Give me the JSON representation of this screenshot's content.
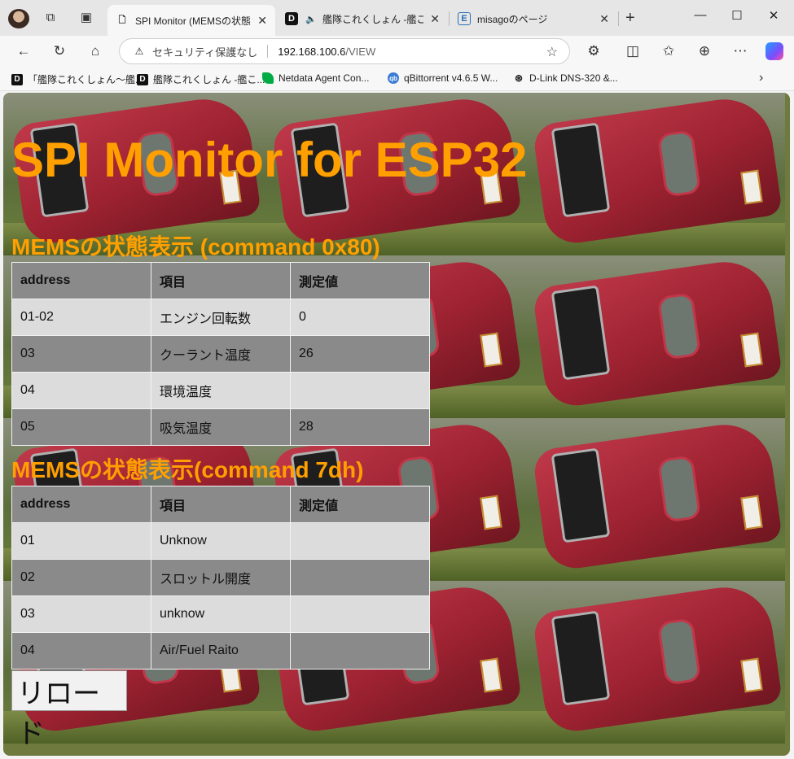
{
  "tabs": [
    {
      "title": "SPI Monitor (MEMSの状態表示",
      "favicon": "page-icon",
      "active": true
    },
    {
      "title": "艦隊これくしょん -艦これ-",
      "favicon": "d-icon",
      "active": false
    },
    {
      "title": "misagoのページ",
      "favicon": "e-icon",
      "active": false
    }
  ],
  "address": {
    "security_text": "セキュリティ保護なし",
    "host": "192.168.100.6",
    "path": "/VIEW"
  },
  "bookmarks": [
    {
      "label": "「艦隊これくしょん～艦...",
      "icon": "d-icon"
    },
    {
      "label": "艦隊これくしょん -艦こ...",
      "icon": "d-icon"
    },
    {
      "label": "Netdata Agent Con...",
      "icon": "netdata-icon"
    },
    {
      "label": "qBittorrent v4.6.5 W...",
      "icon": "qbittorrent-icon"
    },
    {
      "label": "D-Link DNS-320 &...",
      "icon": "dlink-icon"
    }
  ],
  "page": {
    "title": "SPI Monitor for ESP32",
    "section1": {
      "title": "MEMSの状態表示 (command 0x80)",
      "headers": [
        "address",
        "項目",
        "測定値"
      ],
      "rows": [
        [
          "01-02",
          "エンジン回転数",
          "0"
        ],
        [
          "03",
          "クーラント温度",
          "26"
        ],
        [
          "04",
          "環境温度",
          ""
        ],
        [
          "05",
          "吸気温度",
          "28"
        ]
      ]
    },
    "section2": {
      "title": "MEMSの状態表示(command 7dh)",
      "headers": [
        "address",
        "項目",
        "測定値"
      ],
      "rows": [
        [
          "01",
          "Unknow",
          ""
        ],
        [
          "02",
          "スロットル開度",
          ""
        ],
        [
          "03",
          "unknow",
          ""
        ],
        [
          "04",
          "Air/Fuel Raito",
          ""
        ]
      ]
    },
    "reload_label": "リロード"
  },
  "colors": {
    "title_orange": "#ff9f00",
    "row_light": "#dcdcdc",
    "row_dark": "#8a8a8a"
  }
}
